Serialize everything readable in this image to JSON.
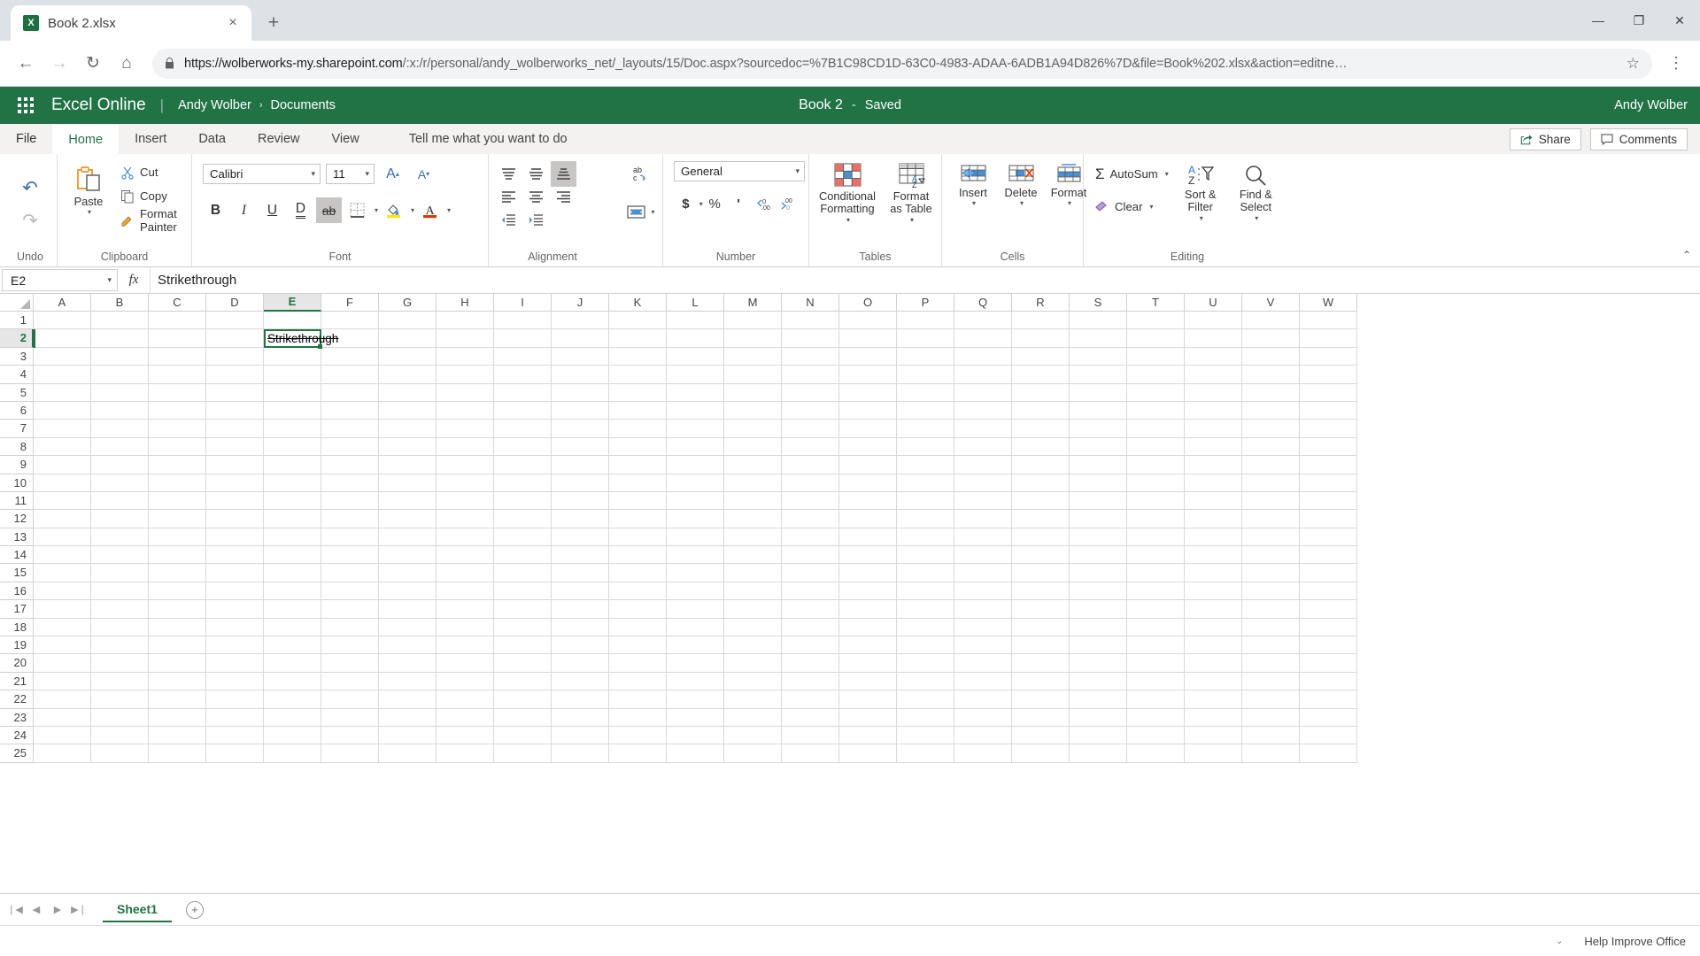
{
  "browser": {
    "tab": {
      "title": "Book 2.xlsx",
      "favicon": "excel-icon",
      "close": "×"
    },
    "new_tab_label": "+",
    "window_controls": {
      "minimize": "—",
      "maximize": "❐",
      "close": "✕"
    },
    "nav": {
      "back": "←",
      "forward": "→",
      "reload": "↻",
      "home": "⌂"
    },
    "omnibox": {
      "lock": "🔒",
      "url_domain": "https://wolberworks-my.sharepoint.com",
      "url_path": "/:x:/r/personal/andy_wolberworks_net/_layouts/15/Doc.aspx?sourcedoc=%7B1C98CD1D-63C0-4983-ADAA-6ADB1A94D826%7D&file=Book%202.xlsx&action=editne…",
      "star": "☆"
    },
    "menu": "⋮"
  },
  "header": {
    "waffle": "app-launcher",
    "brand": "Excel Online",
    "separator": "|",
    "breadcrumb_user": "Andy Wolber",
    "breadcrumb_chevron": "›",
    "breadcrumb_location": "Documents",
    "doc_title": "Book 2",
    "doc_dash": "-",
    "save_state": "Saved",
    "account": "Andy Wolber",
    "brand_color": "#217346"
  },
  "ribbon_tabs": {
    "items": [
      {
        "label": "File",
        "active": false
      },
      {
        "label": "Home",
        "active": true
      },
      {
        "label": "Insert",
        "active": false
      },
      {
        "label": "Data",
        "active": false
      },
      {
        "label": "Review",
        "active": false
      },
      {
        "label": "View",
        "active": false
      }
    ],
    "tell_me": "Tell me what you want to do",
    "share": "Share",
    "comments": "Comments"
  },
  "ribbon": {
    "undo_group": {
      "label": "Undo",
      "undo": "↶",
      "redo": "↷"
    },
    "clipboard": {
      "label": "Clipboard",
      "paste": "Paste",
      "cut": "Cut",
      "copy": "Copy",
      "format_painter": "Format Painter"
    },
    "font": {
      "label": "Font",
      "font_name": "Calibri",
      "font_size": "11",
      "grow_font": "A",
      "shrink_font": "A",
      "bold": "B",
      "italic": "I",
      "underline": "U",
      "double_underline": "D",
      "strikethrough": "ab",
      "strikethrough_active": true,
      "borders": "borders-icon",
      "fill_color": "fill-color-icon",
      "font_color": "font-color-icon"
    },
    "alignment": {
      "label": "Alignment",
      "align_top": "align-top",
      "align_middle": "align-middle",
      "align_bottom": "align-bottom",
      "align_left": "align-left",
      "align_center": "align-center",
      "align_right": "align-right",
      "align_right_active": true,
      "decrease_indent": "decrease-indent",
      "increase_indent": "increase-indent",
      "text_direction": "text-direction",
      "wrap_text": "wrap-text"
    },
    "number": {
      "label": "Number",
      "format": "General",
      "currency": "$",
      "percent": "%",
      "comma": "'",
      "decrease_decimal": "decrease-decimal",
      "increase_decimal": "increase-decimal"
    },
    "tables": {
      "label": "Tables",
      "conditional_formatting": "Conditional Formatting",
      "format_as_table": "Format as Table"
    },
    "cells": {
      "label": "Cells",
      "insert": "Insert",
      "delete": "Delete",
      "format": "Format"
    },
    "editing": {
      "label": "Editing",
      "autosum": "AutoSum",
      "clear": "Clear",
      "sort_filter": "Sort & Filter",
      "find_select": "Find & Select"
    },
    "collapse": "⌃"
  },
  "formula_bar": {
    "name_box": "E2",
    "fx": "fx",
    "value": "Strikethrough"
  },
  "grid": {
    "columns": [
      "A",
      "B",
      "C",
      "D",
      "E",
      "F",
      "G",
      "H",
      "I",
      "J",
      "K",
      "L",
      "M",
      "N",
      "O",
      "P",
      "Q",
      "R",
      "S",
      "T",
      "U",
      "V",
      "W"
    ],
    "rows": [
      "1",
      "2",
      "3",
      "4",
      "5",
      "6",
      "7",
      "8",
      "9",
      "10",
      "11",
      "12",
      "13",
      "14",
      "15",
      "16",
      "17",
      "18",
      "19",
      "20",
      "21",
      "22",
      "23",
      "24",
      "25"
    ],
    "selected_column": "E",
    "selected_row": "2",
    "active_cell": {
      "ref": "E2",
      "value": "Strikethrough",
      "strikethrough": true
    }
  },
  "sheet_bar": {
    "nav_first": "❘◀",
    "nav_prev": "◀",
    "nav_next": "▶",
    "nav_last": "▶❘",
    "tabs": [
      {
        "name": "Sheet1",
        "active": true
      }
    ],
    "add_sheet": "+"
  },
  "status_bar": {
    "caret": "⌄",
    "help": "Help Improve Office"
  }
}
